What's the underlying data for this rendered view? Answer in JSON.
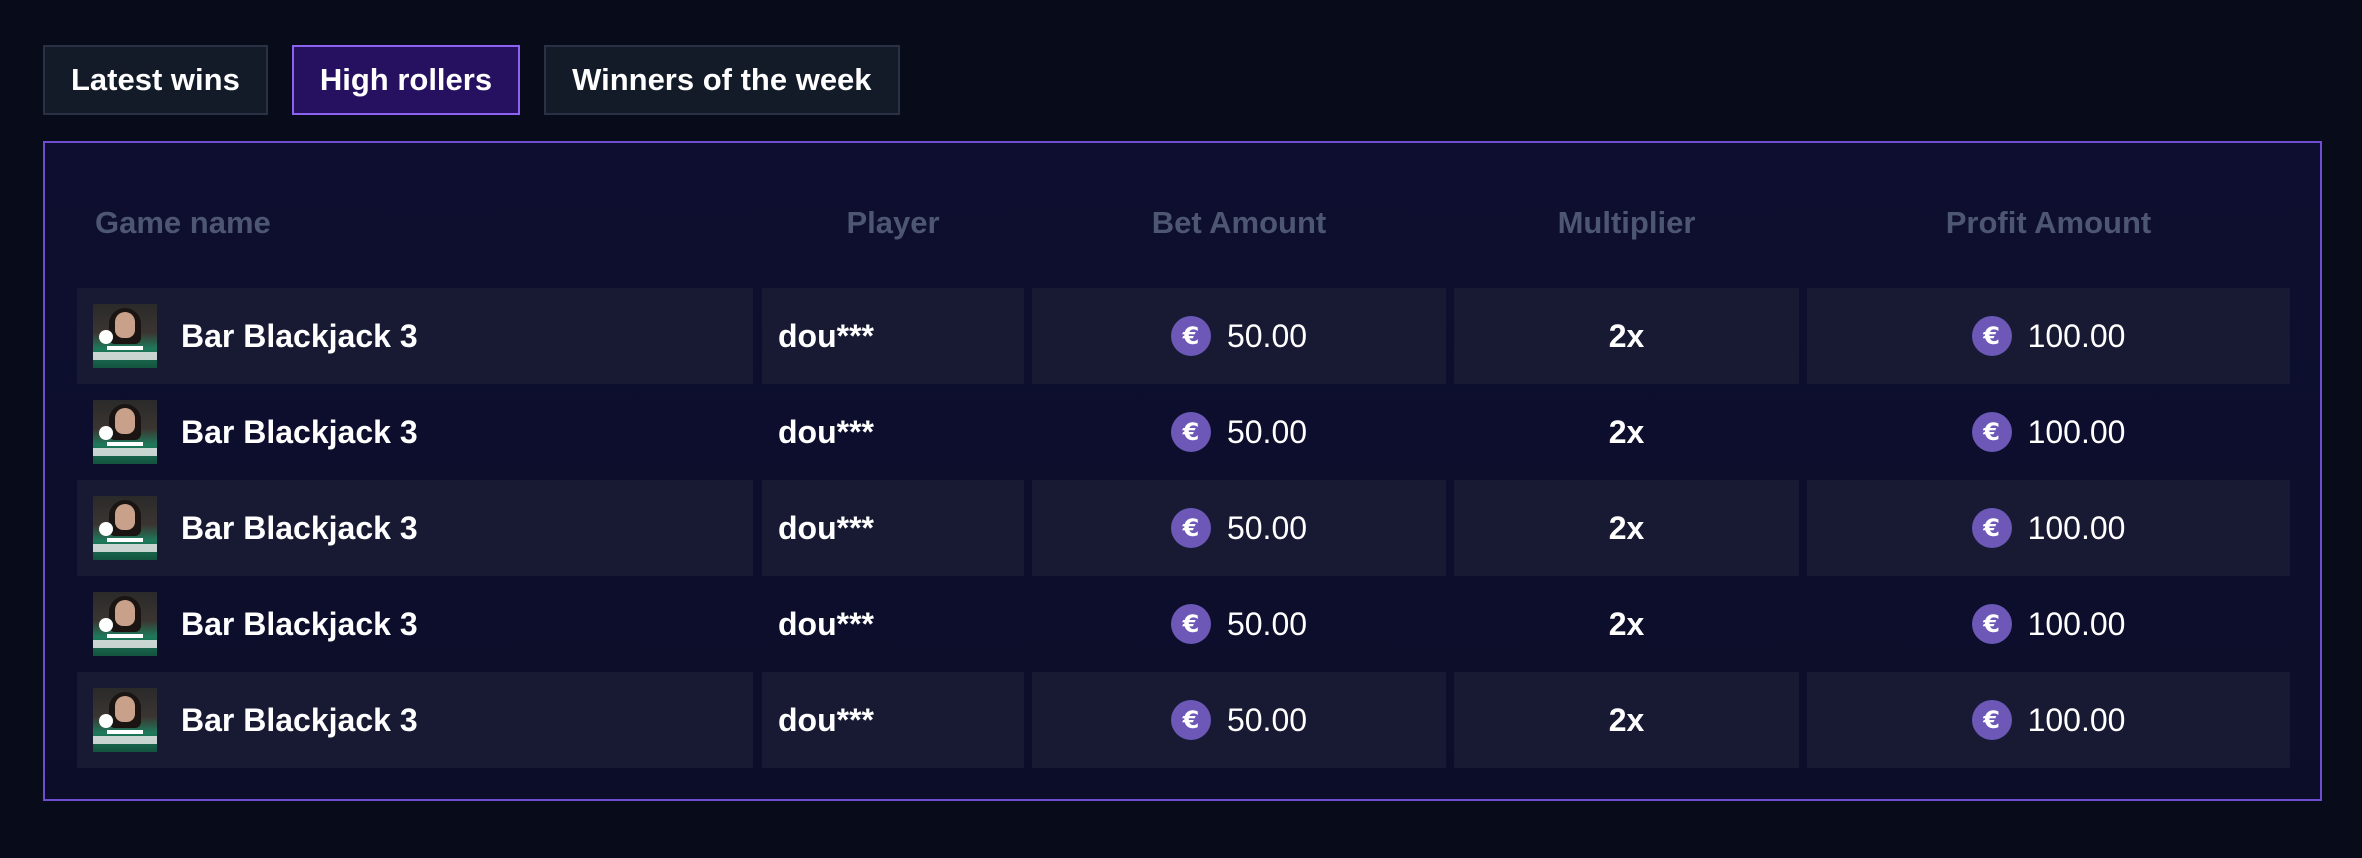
{
  "tabs": [
    {
      "label": "Latest wins",
      "active": false
    },
    {
      "label": "High rollers",
      "active": true
    },
    {
      "label": "Winners of the week",
      "active": false
    }
  ],
  "table": {
    "headers": {
      "game": "Game name",
      "player": "Player",
      "bet": "Bet Amount",
      "multiplier": "Multiplier",
      "profit": "Profit Amount"
    },
    "currency_icon": "euro-icon",
    "currency_symbol": "€",
    "rows": [
      {
        "game": "Bar Blackjack 3",
        "player": "dou***",
        "bet": "50.00",
        "multiplier": "2x",
        "profit": "100.00"
      },
      {
        "game": "Bar Blackjack 3",
        "player": "dou***",
        "bet": "50.00",
        "multiplier": "2x",
        "profit": "100.00"
      },
      {
        "game": "Bar Blackjack 3",
        "player": "dou***",
        "bet": "50.00",
        "multiplier": "2x",
        "profit": "100.00"
      },
      {
        "game": "Bar Blackjack 3",
        "player": "dou***",
        "bet": "50.00",
        "multiplier": "2x",
        "profit": "100.00"
      },
      {
        "game": "Bar Blackjack 3",
        "player": "dou***",
        "bet": "50.00",
        "multiplier": "2x",
        "profit": "100.00"
      }
    ]
  },
  "colors": {
    "background": "#070b1a",
    "accent": "#6e4dd1",
    "active_tab": "#261161",
    "currency_badge": "#6d58b8"
  }
}
